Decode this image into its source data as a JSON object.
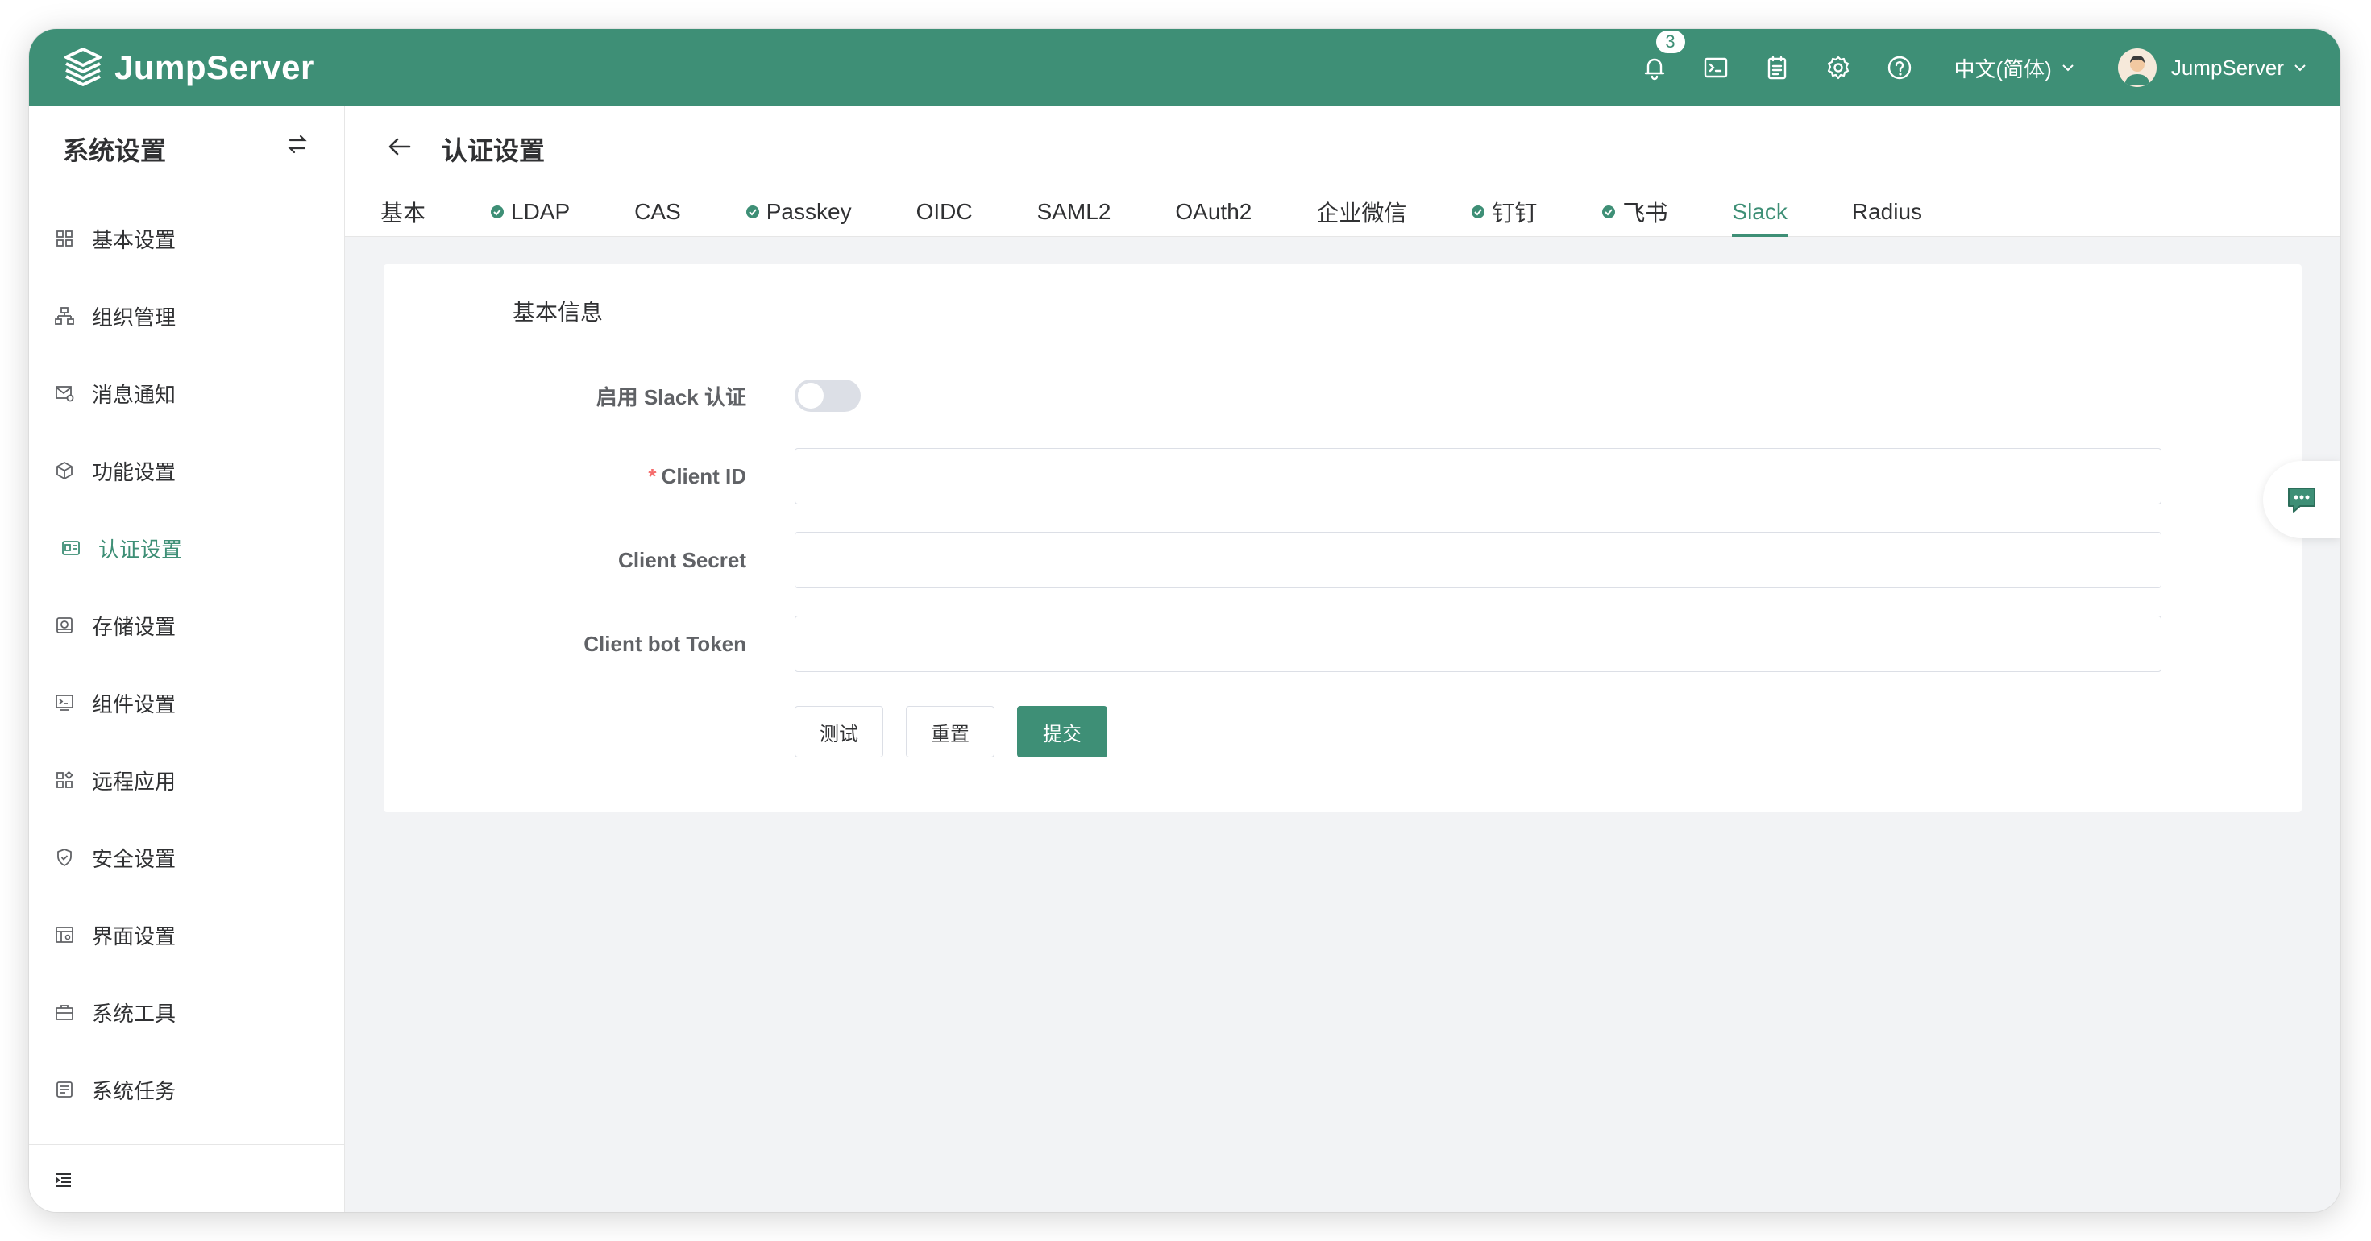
{
  "app": {
    "logo_text": "JumpServer"
  },
  "topbar": {
    "notification_count": "3",
    "language": "中文(简体)",
    "username": "JumpServer"
  },
  "sidebar": {
    "title": "系统设置",
    "items": [
      {
        "label": "基本设置",
        "icon": "grid-icon"
      },
      {
        "label": "组织管理",
        "icon": "org-icon"
      },
      {
        "label": "消息通知",
        "icon": "message-icon"
      },
      {
        "label": "功能设置",
        "icon": "cube-icon"
      },
      {
        "label": "认证设置",
        "icon": "id-card-icon",
        "active": true
      },
      {
        "label": "存储设置",
        "icon": "storage-icon"
      },
      {
        "label": "组件设置",
        "icon": "terminal-icon"
      },
      {
        "label": "远程应用",
        "icon": "apps-icon"
      },
      {
        "label": "安全设置",
        "icon": "shield-icon"
      },
      {
        "label": "界面设置",
        "icon": "layout-icon"
      },
      {
        "label": "系统工具",
        "icon": "toolbox-icon"
      },
      {
        "label": "系统任务",
        "icon": "task-icon"
      }
    ]
  },
  "page": {
    "title": "认证设置"
  },
  "tabs": [
    {
      "label": "基本",
      "enabled": false
    },
    {
      "label": "LDAP",
      "enabled": true
    },
    {
      "label": "CAS",
      "enabled": false
    },
    {
      "label": "Passkey",
      "enabled": true
    },
    {
      "label": "OIDC",
      "enabled": false
    },
    {
      "label": "SAML2",
      "enabled": false
    },
    {
      "label": "OAuth2",
      "enabled": false
    },
    {
      "label": "企业微信",
      "enabled": false
    },
    {
      "label": "钉钉",
      "enabled": true
    },
    {
      "label": "飞书",
      "enabled": true
    },
    {
      "label": "Slack",
      "enabled": false,
      "active": true
    },
    {
      "label": "Radius",
      "enabled": false
    }
  ],
  "form": {
    "section_title": "基本信息",
    "enable_label": "启用 Slack 认证",
    "enable_value": false,
    "client_id_label": "Client ID",
    "client_id_required": "*",
    "client_id_value": "",
    "client_secret_label": "Client Secret",
    "client_secret_value": "",
    "bot_token_label": "Client bot Token",
    "bot_token_value": "",
    "test_label": "测试",
    "reset_label": "重置",
    "submit_label": "提交"
  },
  "colors": {
    "accent": "#3e8f76",
    "required": "#f56c6c"
  }
}
